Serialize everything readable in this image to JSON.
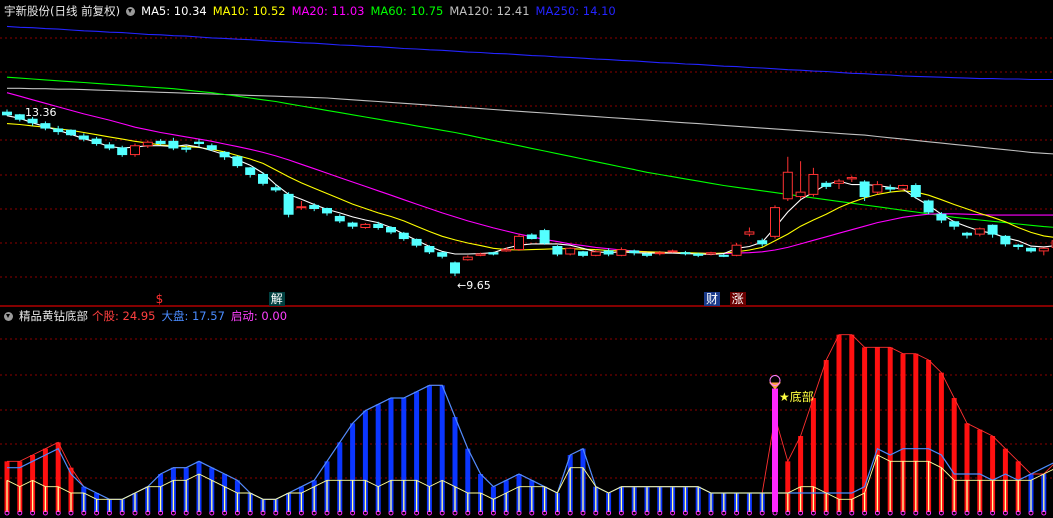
{
  "colors": {
    "up": "#ff3232",
    "down": "#54ffff",
    "ma5": "#ffffff",
    "ma10": "#ffff00",
    "ma20": "#ff00ff",
    "ma60": "#00ff00",
    "ma120": "#c0c0c0",
    "ma250": "#2424ff",
    "grid": "#8b0000",
    "blue_bar": "#0b36ff",
    "red_bar": "#ff1010",
    "yellow_bar": "#ffff9a",
    "qidong": "#ff28ff"
  },
  "top": {
    "title": "宇新股份(日线 前复权)",
    "indicators": [
      {
        "label": "MA5: 10.34",
        "color": "#ffffff"
      },
      {
        "label": "MA10: 10.52",
        "color": "#ffff00"
      },
      {
        "label": "MA20: 11.03",
        "color": "#ff00ff"
      },
      {
        "label": "MA60: 10.75",
        "color": "#00ff00"
      },
      {
        "label": "MA120: 12.41",
        "color": "#c0c0c0"
      },
      {
        "label": "MA250: 14.10",
        "color": "#2424ff"
      }
    ],
    "high_label": "13.36",
    "low_label": "←9.65",
    "markers": [
      {
        "text": "$",
        "color": "#ff3030",
        "bg": "none"
      },
      {
        "text": "解",
        "color": "#ffffff",
        "bg": "#004040"
      },
      {
        "text": "财",
        "color": "#ffffff",
        "bg": "#1a3a8a"
      },
      {
        "text": "涨",
        "color": "#ffffff",
        "bg": "#6a0000"
      }
    ]
  },
  "bottom": {
    "title": "精品黄钻底部",
    "indicators": [
      {
        "label": "个股: 24.95",
        "color": "#ff4040"
      },
      {
        "label": "大盘: 17.57",
        "color": "#4a8cff"
      },
      {
        "label": "启动: 0.00",
        "color": "#ff40ff"
      }
    ],
    "signal_label": "★底部"
  },
  "chart_data": [
    {
      "type": "candlestick",
      "title": "宇新股份(日线 前复权)",
      "ylim": [
        9.2,
        15.4
      ],
      "candles": [
        [
          13.36,
          13.42,
          13.28,
          13.3
        ],
        [
          13.3,
          13.32,
          13.15,
          13.2
        ],
        [
          13.2,
          13.25,
          13.05,
          13.12
        ],
        [
          13.1,
          13.15,
          12.95,
          13.0
        ],
        [
          12.98,
          13.05,
          12.85,
          12.92
        ],
        [
          12.95,
          12.97,
          12.82,
          12.85
        ],
        [
          12.82,
          12.88,
          12.7,
          12.75
        ],
        [
          12.75,
          12.8,
          12.6,
          12.65
        ],
        [
          12.62,
          12.68,
          12.5,
          12.55
        ],
        [
          12.55,
          12.6,
          12.35,
          12.4
        ],
        [
          12.4,
          12.65,
          12.35,
          12.6
        ],
        [
          12.6,
          12.72,
          12.55,
          12.68
        ],
        [
          12.7,
          12.75,
          12.62,
          12.65
        ],
        [
          12.7,
          12.78,
          12.5,
          12.55
        ],
        [
          12.55,
          12.6,
          12.45,
          12.52
        ],
        [
          12.68,
          12.75,
          12.58,
          12.65
        ],
        [
          12.6,
          12.65,
          12.48,
          12.52
        ],
        [
          12.45,
          12.48,
          12.28,
          12.35
        ],
        [
          12.35,
          12.38,
          12.1,
          12.15
        ],
        [
          12.1,
          12.12,
          11.88,
          11.95
        ],
        [
          11.95,
          12.0,
          11.7,
          11.75
        ],
        [
          11.65,
          11.72,
          11.55,
          11.6
        ],
        [
          11.5,
          11.55,
          10.98,
          11.05
        ],
        [
          11.2,
          11.35,
          11.15,
          11.22
        ],
        [
          11.25,
          11.3,
          11.12,
          11.18
        ],
        [
          11.18,
          11.2,
          11.02,
          11.08
        ],
        [
          11.0,
          11.05,
          10.85,
          10.9
        ],
        [
          10.85,
          10.88,
          10.72,
          10.78
        ],
        [
          10.75,
          10.85,
          10.72,
          10.82
        ],
        [
          10.82,
          10.88,
          10.7,
          10.75
        ],
        [
          10.75,
          10.78,
          10.6,
          10.65
        ],
        [
          10.62,
          10.65,
          10.45,
          10.5
        ],
        [
          10.48,
          10.5,
          10.3,
          10.35
        ],
        [
          10.32,
          10.35,
          10.15,
          10.2
        ],
        [
          10.18,
          10.2,
          10.05,
          10.1
        ],
        [
          9.95,
          9.98,
          9.65,
          9.72
        ],
        [
          10.02,
          10.12,
          10.0,
          10.08
        ],
        [
          10.12,
          10.18,
          10.1,
          10.15
        ],
        [
          10.18,
          10.2,
          10.12,
          10.15
        ],
        [
          10.22,
          10.3,
          10.2,
          10.25
        ],
        [
          10.25,
          10.6,
          10.22,
          10.55
        ],
        [
          10.58,
          10.62,
          10.48,
          10.5
        ],
        [
          10.68,
          10.72,
          10.36,
          10.4
        ],
        [
          10.32,
          10.35,
          10.1,
          10.15
        ],
        [
          10.15,
          10.3,
          10.12,
          10.28
        ],
        [
          10.2,
          10.22,
          10.08,
          10.12
        ],
        [
          10.12,
          10.25,
          10.1,
          10.2
        ],
        [
          10.22,
          10.28,
          10.1,
          10.15
        ],
        [
          10.12,
          10.3,
          10.1,
          10.25
        ],
        [
          10.22,
          10.25,
          10.12,
          10.18
        ],
        [
          10.15,
          10.18,
          10.08,
          10.12
        ],
        [
          10.18,
          10.22,
          10.12,
          10.18
        ],
        [
          10.2,
          10.25,
          10.18,
          10.22
        ],
        [
          10.18,
          10.22,
          10.12,
          10.16
        ],
        [
          10.15,
          10.18,
          10.08,
          10.12
        ],
        [
          10.15,
          10.2,
          10.12,
          10.18
        ],
        [
          10.12,
          10.15,
          10.08,
          10.1
        ],
        [
          10.12,
          10.4,
          10.1,
          10.35
        ],
        [
          10.6,
          10.75,
          10.55,
          10.65
        ],
        [
          10.45,
          10.5,
          10.32,
          10.38
        ],
        [
          10.55,
          11.25,
          10.5,
          11.2
        ],
        [
          11.4,
          12.35,
          11.35,
          12.0
        ],
        [
          11.45,
          12.25,
          11.4,
          11.55
        ],
        [
          11.5,
          12.1,
          11.45,
          11.95
        ],
        [
          11.75,
          11.8,
          11.62,
          11.68
        ],
        [
          11.75,
          11.85,
          11.62,
          11.8
        ],
        [
          11.85,
          11.92,
          11.78,
          11.88
        ],
        [
          11.78,
          11.82,
          11.35,
          11.45
        ],
        [
          11.55,
          11.8,
          11.5,
          11.72
        ],
        [
          11.65,
          11.72,
          11.55,
          11.62
        ],
        [
          11.62,
          11.72,
          11.6,
          11.7
        ],
        [
          11.7,
          11.75,
          11.4,
          11.45
        ],
        [
          11.35,
          11.38,
          11.05,
          11.1
        ],
        [
          11.05,
          11.1,
          10.85,
          10.92
        ],
        [
          10.88,
          10.9,
          10.7,
          10.78
        ],
        [
          10.62,
          10.65,
          10.5,
          10.58
        ],
        [
          10.6,
          10.75,
          10.55,
          10.72
        ],
        [
          10.8,
          10.82,
          10.52,
          10.6
        ],
        [
          10.55,
          10.58,
          10.32,
          10.38
        ],
        [
          10.35,
          10.38,
          10.25,
          10.32
        ],
        [
          10.28,
          10.3,
          10.18,
          10.22
        ],
        [
          10.22,
          10.3,
          10.12,
          10.28
        ],
        [
          10.3,
          10.55,
          10.25,
          10.45
        ]
      ],
      "ma5": [
        13.28,
        13.22,
        13.12,
        13.03,
        12.95,
        12.86,
        12.76,
        12.68,
        12.58,
        12.55,
        12.57,
        12.6,
        12.6,
        12.58,
        12.62,
        12.57,
        12.49,
        12.4,
        12.28,
        12.16,
        11.98,
        11.72,
        11.5,
        11.39,
        11.27,
        11.16,
        11.08,
        10.99,
        10.92,
        10.86,
        10.75,
        10.6,
        10.46,
        10.32,
        10.21,
        10.15,
        10.15,
        10.16,
        10.18,
        10.28,
        10.35,
        10.38,
        10.38,
        10.38,
        10.35,
        10.28,
        10.2,
        10.18,
        10.2,
        10.18,
        10.17,
        10.17,
        10.17,
        10.16,
        10.15,
        10.14,
        10.16,
        10.28,
        10.32,
        10.42,
        10.75,
        11.1,
        11.38,
        11.55,
        11.72,
        11.8,
        11.72,
        11.72,
        11.7,
        11.66,
        11.62,
        11.42,
        11.25,
        11.05,
        10.88,
        10.77,
        10.67,
        10.62,
        10.52,
        10.45,
        10.33,
        10.31,
        10.34
      ],
      "ma10": [
        13.1,
        13.08,
        13.05,
        13.02,
        12.98,
        12.95,
        12.9,
        12.85,
        12.8,
        12.75,
        12.7,
        12.66,
        12.62,
        12.6,
        12.58,
        12.56,
        12.52,
        12.46,
        12.38,
        12.3,
        12.2,
        12.05,
        11.9,
        11.76,
        11.64,
        11.52,
        11.4,
        11.28,
        11.18,
        11.08,
        11.0,
        10.9,
        10.78,
        10.66,
        10.55,
        10.47,
        10.4,
        10.34,
        10.28,
        10.25,
        10.24,
        10.25,
        10.26,
        10.27,
        10.27,
        10.26,
        10.25,
        10.23,
        10.22,
        10.21,
        10.2,
        10.19,
        10.18,
        10.18,
        10.17,
        10.16,
        10.17,
        10.2,
        10.24,
        10.3,
        10.45,
        10.6,
        10.78,
        10.92,
        11.05,
        11.2,
        11.32,
        11.42,
        11.5,
        11.55,
        11.58,
        11.55,
        11.48,
        11.38,
        11.27,
        11.17,
        11.07,
        10.98,
        10.88,
        10.75,
        10.64,
        10.56,
        10.52
      ],
      "ma20": [
        13.8,
        13.72,
        13.64,
        13.56,
        13.48,
        13.4,
        13.32,
        13.25,
        13.18,
        13.1,
        13.02,
        12.96,
        12.9,
        12.85,
        12.8,
        12.75,
        12.7,
        12.64,
        12.58,
        12.52,
        12.45,
        12.37,
        12.28,
        12.18,
        12.08,
        11.98,
        11.88,
        11.78,
        11.68,
        11.58,
        11.48,
        11.38,
        11.28,
        11.18,
        11.08,
        10.99,
        10.9,
        10.82,
        10.74,
        10.67,
        10.6,
        10.54,
        10.48,
        10.43,
        10.38,
        10.34,
        10.3,
        10.27,
        10.24,
        10.22,
        10.2,
        10.19,
        10.18,
        10.17,
        10.17,
        10.16,
        10.16,
        10.17,
        10.18,
        10.2,
        10.24,
        10.3,
        10.38,
        10.46,
        10.54,
        10.62,
        10.7,
        10.78,
        10.86,
        10.92,
        10.98,
        11.02,
        11.05,
        11.06,
        11.06,
        11.05,
        11.04,
        11.03,
        11.03,
        11.03,
        11.03,
        11.03,
        11.03
      ],
      "ma60": [
        14.15,
        14.13,
        14.11,
        14.09,
        14.07,
        14.05,
        14.03,
        14.01,
        13.99,
        13.97,
        13.95,
        13.93,
        13.91,
        13.89,
        13.86,
        13.83,
        13.8,
        13.76,
        13.72,
        13.68,
        13.64,
        13.6,
        13.55,
        13.5,
        13.45,
        13.4,
        13.35,
        13.3,
        13.25,
        13.2,
        13.15,
        13.1,
        13.05,
        13.0,
        12.95,
        12.9,
        12.84,
        12.78,
        12.72,
        12.66,
        12.6,
        12.54,
        12.48,
        12.42,
        12.36,
        12.3,
        12.24,
        12.18,
        12.12,
        12.06,
        12.0,
        11.95,
        11.9,
        11.85,
        11.8,
        11.75,
        11.7,
        11.66,
        11.62,
        11.58,
        11.54,
        11.5,
        11.46,
        11.42,
        11.38,
        11.34,
        11.3,
        11.26,
        11.22,
        11.18,
        11.14,
        11.1,
        11.06,
        11.02,
        10.98,
        10.95,
        10.92,
        10.89,
        10.86,
        10.83,
        10.8,
        10.77,
        10.75
      ],
      "ma120": [
        13.9,
        13.9,
        13.89,
        13.89,
        13.88,
        13.88,
        13.87,
        13.86,
        13.85,
        13.84,
        13.83,
        13.82,
        13.81,
        13.8,
        13.79,
        13.78,
        13.77,
        13.76,
        13.75,
        13.74,
        13.73,
        13.72,
        13.71,
        13.7,
        13.69,
        13.68,
        13.66,
        13.64,
        13.62,
        13.6,
        13.58,
        13.56,
        13.54,
        13.52,
        13.5,
        13.48,
        13.46,
        13.44,
        13.42,
        13.4,
        13.38,
        13.36,
        13.34,
        13.32,
        13.3,
        13.28,
        13.26,
        13.24,
        13.22,
        13.2,
        13.18,
        13.16,
        13.14,
        13.12,
        13.1,
        13.08,
        13.06,
        13.04,
        13.02,
        13.0,
        12.98,
        12.96,
        12.94,
        12.92,
        12.9,
        12.88,
        12.86,
        12.84,
        12.81,
        12.78,
        12.75,
        12.72,
        12.69,
        12.66,
        12.63,
        12.6,
        12.57,
        12.54,
        12.51,
        12.48,
        12.45,
        12.43,
        12.41
      ],
      "ma250": [
        15.3,
        15.28,
        15.27,
        15.25,
        15.24,
        15.22,
        15.2,
        15.19,
        15.17,
        15.16,
        15.14,
        15.12,
        15.11,
        15.09,
        15.08,
        15.06,
        15.04,
        15.03,
        15.01,
        15.0,
        14.98,
        14.96,
        14.95,
        14.93,
        14.92,
        14.9,
        14.88,
        14.87,
        14.85,
        14.84,
        14.82,
        14.8,
        14.79,
        14.77,
        14.76,
        14.74,
        14.72,
        14.71,
        14.69,
        14.68,
        14.66,
        14.64,
        14.63,
        14.61,
        14.6,
        14.58,
        14.56,
        14.55,
        14.53,
        14.52,
        14.5,
        14.48,
        14.47,
        14.45,
        14.44,
        14.42,
        14.4,
        14.39,
        14.37,
        14.36,
        14.34,
        14.32,
        14.31,
        14.29,
        14.28,
        14.26,
        14.24,
        14.23,
        14.21,
        14.2,
        14.18,
        14.17,
        14.16,
        14.15,
        14.14,
        14.13,
        14.12,
        14.12,
        14.11,
        14.11,
        14.1,
        14.1,
        14.1
      ]
    },
    {
      "type": "bar",
      "title": "精品黄钻底部",
      "ylim": [
        0,
        30
      ],
      "series_geguo": [
        8,
        8,
        9,
        10,
        11,
        7,
        4,
        3,
        2,
        2,
        3,
        4,
        6,
        7,
        7,
        8,
        7,
        6,
        5,
        3,
        2,
        2,
        3,
        4,
        5,
        8,
        11,
        14,
        16,
        17,
        18,
        18,
        19,
        20,
        20,
        15,
        10,
        6,
        4,
        5,
        6,
        5,
        4,
        3,
        9,
        10,
        4,
        3,
        4,
        4,
        4,
        4,
        4,
        4,
        4,
        3,
        3,
        3,
        3,
        3,
        15,
        8,
        12,
        18,
        24,
        28,
        28,
        26,
        26,
        26,
        25,
        25,
        24,
        22,
        18,
        14,
        13,
        12,
        10,
        8,
        6,
        6,
        8
      ],
      "series_dapan": [
        7,
        7,
        8,
        9,
        10,
        6,
        4,
        3,
        2,
        2,
        3,
        4,
        6,
        7,
        7,
        8,
        7,
        6,
        5,
        3,
        2,
        2,
        3,
        4,
        5,
        8,
        11,
        14,
        16,
        17,
        18,
        18,
        19,
        20,
        20,
        15,
        10,
        6,
        4,
        5,
        6,
        5,
        4,
        3,
        9,
        10,
        4,
        3,
        4,
        4,
        4,
        4,
        4,
        4,
        4,
        3,
        3,
        3,
        3,
        3,
        3,
        3,
        3,
        3,
        3,
        3,
        3,
        4,
        10,
        9,
        10,
        10,
        10,
        9,
        6,
        6,
        6,
        5,
        6,
        5,
        6,
        7,
        8
      ],
      "series_yellow": [
        5,
        4,
        5,
        4,
        4,
        3,
        3,
        2,
        2,
        2,
        3,
        4,
        4,
        5,
        5,
        6,
        5,
        4,
        3,
        3,
        2,
        2,
        3,
        3,
        4,
        5,
        5,
        5,
        5,
        4,
        5,
        5,
        5,
        4,
        5,
        4,
        3,
        3,
        2,
        3,
        4,
        4,
        4,
        3,
        7,
        7,
        4,
        3,
        4,
        4,
        4,
        4,
        4,
        4,
        4,
        3,
        3,
        3,
        3,
        3,
        3,
        3,
        4,
        4,
        3,
        2,
        2,
        3,
        9,
        8,
        8,
        8,
        8,
        7,
        5,
        5,
        5,
        5,
        5,
        5,
        5,
        6,
        7
      ],
      "signal_index": 60
    }
  ]
}
